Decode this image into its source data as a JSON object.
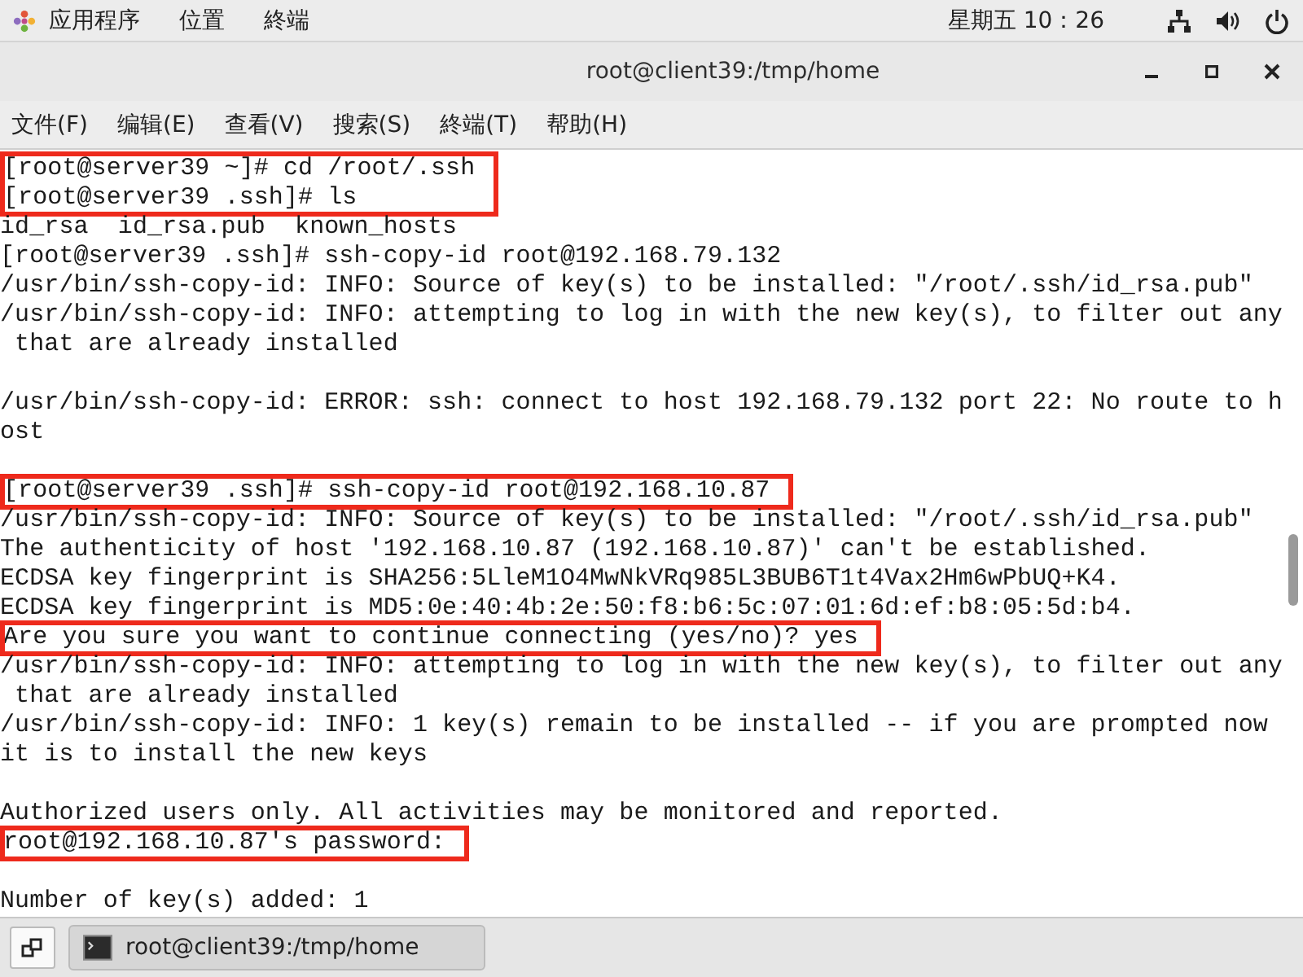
{
  "top_bar": {
    "menus": [
      "应用程序",
      "位置",
      "終端"
    ],
    "clock": "星期五 10：26"
  },
  "window": {
    "title": "root@client39:/tmp/home"
  },
  "menu_bar": [
    "文件(F)",
    "编辑(E)",
    "查看(V)",
    "搜索(S)",
    "終端(T)",
    "帮助(H)"
  ],
  "terminal": {
    "lines": [
      {
        "kind": "text",
        "text": "[root@server39 ~]# cd /root/.ssh",
        "highlighted": true
      },
      {
        "kind": "text",
        "text": "[root@server39 .ssh]# ls",
        "highlighted": true
      },
      {
        "kind": "text",
        "text": "id_rsa  id_rsa.pub  known_hosts",
        "highlighted": false
      },
      {
        "kind": "text",
        "text": "[root@server39 .ssh]# ssh-copy-id root@192.168.79.132",
        "highlighted": false
      },
      {
        "kind": "text",
        "text": "/usr/bin/ssh-copy-id: INFO: Source of key(s) to be installed: \"/root/.ssh/id_rsa.pub\"",
        "highlighted": false
      },
      {
        "kind": "text",
        "text": "/usr/bin/ssh-copy-id: INFO: attempting to log in with the new key(s), to filter out any",
        "highlighted": false
      },
      {
        "kind": "text",
        "text": " that are already installed",
        "highlighted": false
      },
      {
        "kind": "blank"
      },
      {
        "kind": "text",
        "text": "/usr/bin/ssh-copy-id: ERROR: ssh: connect to host 192.168.79.132 port 22: No route to h",
        "highlighted": false
      },
      {
        "kind": "text",
        "text": "ost",
        "highlighted": false
      },
      {
        "kind": "blank"
      },
      {
        "kind": "text",
        "text": "[root@server39 .ssh]# ssh-copy-id root@192.168.10.87",
        "highlighted": true
      },
      {
        "kind": "text",
        "text": "/usr/bin/ssh-copy-id: INFO: Source of key(s) to be installed: \"/root/.ssh/id_rsa.pub\"",
        "highlighted": false
      },
      {
        "kind": "text",
        "text": "The authenticity of host '192.168.10.87 (192.168.10.87)' can't be established.",
        "highlighted": false
      },
      {
        "kind": "text",
        "text": "ECDSA key fingerprint is SHA256:5LleM1O4MwNkVRq985L3BUB6T1t4Vax2Hm6wPbUQ+K4.",
        "highlighted": false
      },
      {
        "kind": "text",
        "text": "ECDSA key fingerprint is MD5:0e:40:4b:2e:50:f8:b6:5c:07:01:6d:ef:b8:05:5d:b4.",
        "highlighted": false
      },
      {
        "kind": "text",
        "text": "Are you sure you want to continue connecting (yes/no)? yes",
        "highlighted": true
      },
      {
        "kind": "text",
        "text": "/usr/bin/ssh-copy-id: INFO: attempting to log in with the new key(s), to filter out any",
        "highlighted": false
      },
      {
        "kind": "text",
        "text": " that are already installed",
        "highlighted": false
      },
      {
        "kind": "text",
        "text": "/usr/bin/ssh-copy-id: INFO: 1 key(s) remain to be installed -- if you are prompted now",
        "highlighted": false
      },
      {
        "kind": "text",
        "text": "it is to install the new keys",
        "highlighted": false
      },
      {
        "kind": "blank"
      },
      {
        "kind": "text",
        "text": "Authorized users only. All activities may be monitored and reported.",
        "highlighted": false
      },
      {
        "kind": "text",
        "text": "root@192.168.10.87's password:",
        "highlighted": true
      },
      {
        "kind": "blank"
      },
      {
        "kind": "text",
        "text": "Number of key(s) added: 1",
        "highlighted": false
      }
    ]
  },
  "taskbar": {
    "tasks": [
      {
        "label": "root@client39:/tmp/home",
        "selected": true
      }
    ]
  }
}
